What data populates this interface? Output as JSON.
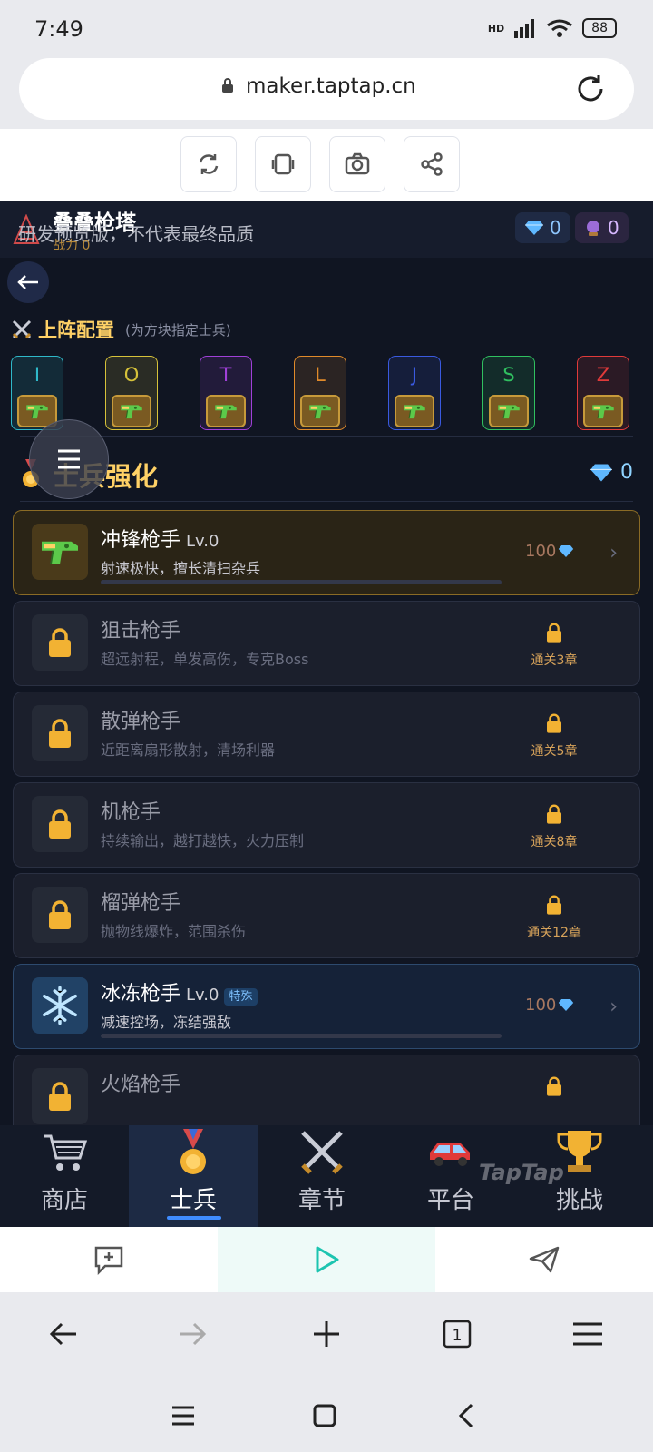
{
  "status": {
    "time": "7:49",
    "network": "HD",
    "battery": "88"
  },
  "browser": {
    "url": "maker.taptap.cn"
  },
  "game": {
    "title": "叠叠枪塔",
    "watermark": "研发预览版，不代表最终品质",
    "power_label": "战力 0",
    "currency": {
      "gems": "0",
      "orbs": "0"
    },
    "lineup": {
      "title": "上阵配置",
      "hint": "(为方块指定士兵)",
      "slots": [
        {
          "letter": "I",
          "color": "#2fb8c9"
        },
        {
          "letter": "O",
          "color": "#d6c23a"
        },
        {
          "letter": "T",
          "color": "#a040d8"
        },
        {
          "letter": "L",
          "color": "#e08a2a"
        },
        {
          "letter": "J",
          "color": "#3a5ae0"
        },
        {
          "letter": "S",
          "color": "#30c060"
        },
        {
          "letter": "Z",
          "color": "#e03a3a"
        }
      ]
    },
    "upgrade": {
      "title": "士兵强化",
      "gems": "0",
      "soldiers": [
        {
          "name": "冲锋枪手",
          "level": "Lv.0",
          "desc": "射速极快，擅长清扫杂兵",
          "cost": "100",
          "state": "active",
          "icon": "water-gun-icon"
        },
        {
          "name": "狙击枪手",
          "desc": "超远射程，单发高伤，专克Boss",
          "requirement": "通关3章",
          "state": "locked"
        },
        {
          "name": "散弹枪手",
          "desc": "近距离扇形散射，清场利器",
          "requirement": "通关5章",
          "state": "locked"
        },
        {
          "name": "机枪手",
          "desc": "持续输出，越打越快，火力压制",
          "requirement": "通关8章",
          "state": "locked"
        },
        {
          "name": "榴弹枪手",
          "desc": "抛物线爆炸，范围杀伤",
          "requirement": "通关12章",
          "state": "locked"
        },
        {
          "name": "冰冻枪手",
          "level": "Lv.0",
          "badge": "特殊",
          "desc": "减速控场，冻结强敌",
          "cost": "100",
          "state": "special",
          "icon": "snowflake-icon"
        },
        {
          "name": "火焰枪手",
          "state": "locked"
        }
      ]
    },
    "nav": [
      {
        "label": "商店",
        "icon": "shopping-cart-icon"
      },
      {
        "label": "士兵",
        "icon": "medal-icon",
        "selected": true
      },
      {
        "label": "章节",
        "icon": "crossed-swords-icon"
      },
      {
        "label": "平台",
        "icon": "car-icon"
      },
      {
        "label": "挑战",
        "icon": "trophy-icon"
      }
    ],
    "brand_watermark": "TapTap"
  }
}
